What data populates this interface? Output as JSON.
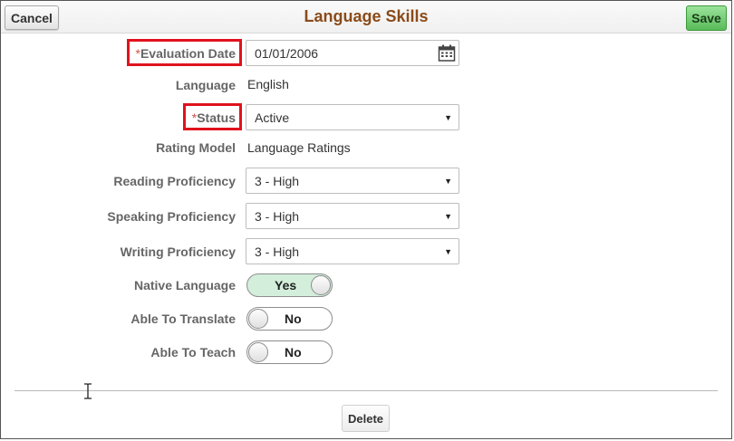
{
  "header": {
    "title": "Language Skills",
    "cancel_label": "Cancel",
    "save_label": "Save"
  },
  "form": {
    "required_marker": "*",
    "evaluation_date": {
      "label": "Evaluation Date",
      "value": "01/01/2006",
      "icon": "calendar-icon"
    },
    "language": {
      "label": "Language",
      "value": "English"
    },
    "status": {
      "label": "Status",
      "value": "Active"
    },
    "rating_model": {
      "label": "Rating Model",
      "value": "Language Ratings"
    },
    "reading_proficiency": {
      "label": "Reading Proficiency",
      "value": "3 - High"
    },
    "speaking_proficiency": {
      "label": "Speaking Proficiency",
      "value": "3 - High"
    },
    "writing_proficiency": {
      "label": "Writing Proficiency",
      "value": "3 - High"
    },
    "native_language": {
      "label": "Native Language",
      "value": "Yes"
    },
    "able_to_translate": {
      "label": "Able To Translate",
      "value": "No"
    },
    "able_to_teach": {
      "label": "Able To Teach",
      "value": "No"
    }
  },
  "footer": {
    "delete_label": "Delete"
  },
  "colors": {
    "title": "#8a4b1a",
    "save_button": "#58bb58",
    "highlight_box": "#e0131e",
    "toggle_on": "#d3efdc"
  }
}
